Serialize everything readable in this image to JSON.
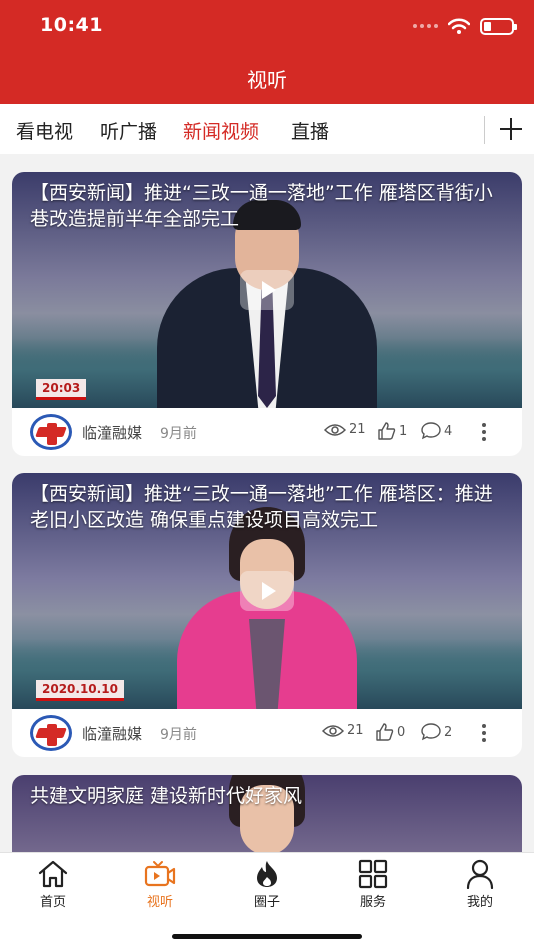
{
  "status_bar": {
    "time": "10:41"
  },
  "header": {
    "title": "视听"
  },
  "tabs": [
    {
      "label": "看电视"
    },
    {
      "label": "听广播"
    },
    {
      "label": "新闻视频",
      "active": true
    },
    {
      "label": "直播"
    }
  ],
  "videos": [
    {
      "title": "【西安新闻】推进“三改一通一落地”工作 雁塔区背街小巷改造提前半年全部完工",
      "timestamp": "20:03",
      "source": "临潼融媒",
      "time": "9月前",
      "views": "21",
      "likes": "1",
      "comments": "4"
    },
    {
      "title": "【西安新闻】推进“三改一通一落地”工作 雁塔区：推进老旧小区改造 确保重点建设项目高效完工",
      "timestamp": "2020.10.10",
      "source": "临潼融媒",
      "time": "9月前",
      "views": "21",
      "likes": "0",
      "comments": "2"
    },
    {
      "title": "共建文明家庭 建设新时代好家风"
    }
  ],
  "bottom_nav": [
    {
      "label": "首页",
      "icon": "home-icon"
    },
    {
      "label": "视听",
      "icon": "video-icon",
      "active": true
    },
    {
      "label": "圈子",
      "icon": "flame-icon"
    },
    {
      "label": "服务",
      "icon": "grid-icon"
    },
    {
      "label": "我的",
      "icon": "user-icon"
    }
  ],
  "colors": {
    "brand_red": "#d42a25",
    "active_orange": "#e8741f"
  }
}
